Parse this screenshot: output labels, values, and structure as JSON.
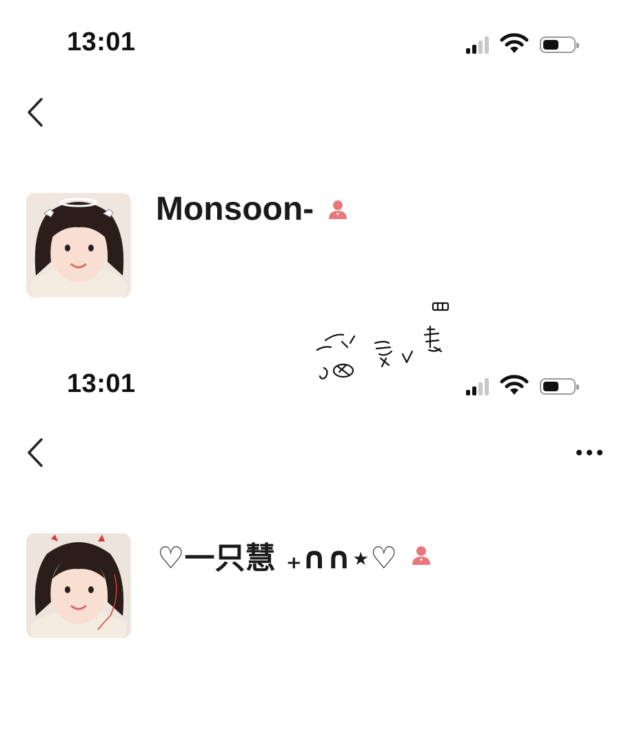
{
  "screens": [
    {
      "status_bar": {
        "time": "13:01",
        "signal_bars": 2,
        "signal_total": 4,
        "battery_level": 0.45
      },
      "profile": {
        "name": "Monsoon-"
      }
    },
    {
      "status_bar": {
        "time": "13:01",
        "signal_bars": 2,
        "signal_total": 4,
        "battery_level": 0.45
      },
      "profile": {
        "name": "♡一只慧 ₊∩∩⋆♡"
      }
    }
  ],
  "colors": {
    "badge": "#e8787c",
    "text": "#111111",
    "accent_red": "#d63a3a"
  },
  "icons": {
    "back": "chevron-left-icon",
    "more": "more-horizontal-icon",
    "badge": "person-badge-icon",
    "signal": "signal-icon",
    "wifi": "wifi-icon",
    "battery": "battery-icon"
  }
}
